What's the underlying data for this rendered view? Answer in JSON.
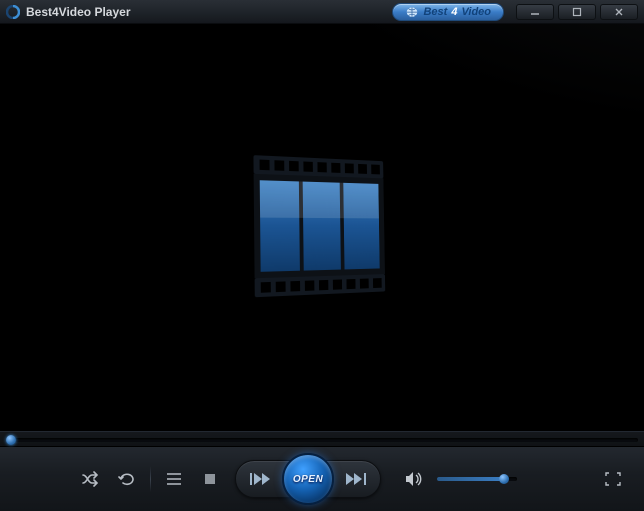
{
  "titlebar": {
    "app_title": "Best4Video Player",
    "brand": {
      "word1": "Best",
      "word2": "4",
      "word3": "Video"
    }
  },
  "controls": {
    "open_label": "OPEN",
    "volume_percent": 80
  },
  "colors": {
    "accent": "#2e6fb0",
    "brand_blue": "#1563b5"
  }
}
